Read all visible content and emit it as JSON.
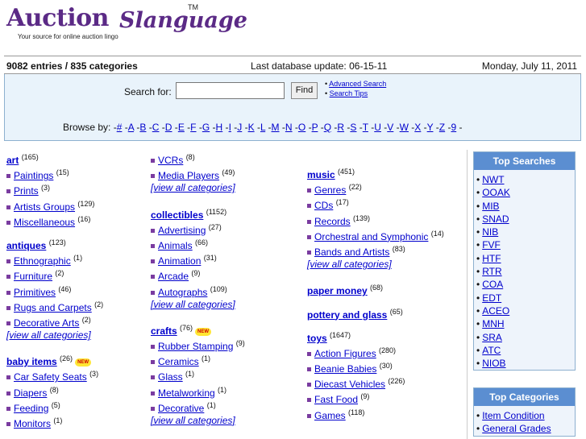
{
  "logo": {
    "main": "Auction",
    "script": "Slanguage",
    "tm": "TM",
    "tagline": "Your source for online auction lingo"
  },
  "info": {
    "entries": "9082 entries / 835 categories",
    "updated": "Last database update: 06-15-11",
    "date": "Monday, July 11, 2011"
  },
  "search": {
    "label": "Search for:",
    "input_value": "",
    "button": "Find",
    "advanced": "Advanced Search",
    "tips": "Search Tips",
    "browse_label": "Browse by:",
    "letters": [
      "#",
      "A",
      "B",
      "C",
      "D",
      "E",
      "F",
      "G",
      "H",
      "I",
      "J",
      "K",
      "L",
      "M",
      "N",
      "O",
      "P",
      "Q",
      "R",
      "S",
      "T",
      "U",
      "V",
      "W",
      "X",
      "Y",
      "Z",
      "9"
    ]
  },
  "columns": {
    "col1": [
      {
        "name": "art",
        "count": "165",
        "subs": [
          {
            "name": "Paintings",
            "count": "15"
          },
          {
            "name": "Prints",
            "count": "3"
          },
          {
            "name": "Artists Groups",
            "count": "129"
          },
          {
            "name": "Miscellaneous",
            "count": "16"
          }
        ],
        "viewall": ""
      },
      {
        "name": "antiques",
        "count": "123",
        "subs": [
          {
            "name": "Ethnographic",
            "count": "1"
          },
          {
            "name": "Furniture",
            "count": "2"
          },
          {
            "name": "Primitives",
            "count": "46"
          },
          {
            "name": "Rugs and Carpets",
            "count": "2"
          },
          {
            "name": "Decorative Arts",
            "count": "2"
          }
        ],
        "viewall": "[view all categories]"
      },
      {
        "name": "baby items",
        "count": "26",
        "new": "NEW",
        "subs": [
          {
            "name": "Car Safety Seats",
            "count": "3"
          },
          {
            "name": "Diapers",
            "count": "8"
          },
          {
            "name": "Feeding",
            "count": "5"
          },
          {
            "name": "Monitors",
            "count": "1"
          }
        ],
        "viewall": ""
      }
    ],
    "col2": [
      {
        "name": "",
        "count": "",
        "subs": [
          {
            "name": "VCRs",
            "count": "8"
          },
          {
            "name": "Media Players",
            "count": "49"
          }
        ],
        "viewall": "[view all categories]"
      },
      {
        "name": "collectibles",
        "count": "1152",
        "subs": [
          {
            "name": "Advertising",
            "count": "27"
          },
          {
            "name": "Animals",
            "count": "66"
          },
          {
            "name": "Animation",
            "count": "31"
          },
          {
            "name": "Arcade",
            "count": "9"
          },
          {
            "name": "Autographs",
            "count": "109"
          }
        ],
        "viewall": "[view all categories]"
      },
      {
        "name": "crafts",
        "count": "76",
        "new": "NEW",
        "subs": [
          {
            "name": "Rubber Stamping",
            "count": "9"
          },
          {
            "name": "Ceramics",
            "count": "1"
          },
          {
            "name": "Glass",
            "count": "1"
          },
          {
            "name": "Metalworking",
            "count": "1"
          },
          {
            "name": "Decorative",
            "count": "1"
          }
        ],
        "viewall": "[view all categories]"
      }
    ],
    "col3": [
      {
        "name": "music",
        "count": "451",
        "subs": [
          {
            "name": "Genres",
            "count": "22"
          },
          {
            "name": "CDs",
            "count": "17"
          },
          {
            "name": "Records",
            "count": "139"
          },
          {
            "name": "Orchestral and Symphonic",
            "count": "14"
          },
          {
            "name": "Bands and Artists",
            "count": "83"
          }
        ],
        "viewall": "[view all categories]"
      },
      {
        "name": "paper money",
        "count": "68",
        "subs": [],
        "viewall": ""
      },
      {
        "name": "pottery and glass",
        "count": "65",
        "subs": [],
        "viewall": ""
      },
      {
        "name": "toys",
        "count": "1647",
        "subs": [
          {
            "name": "Action Figures",
            "count": "280"
          },
          {
            "name": "Beanie Babies",
            "count": "30"
          },
          {
            "name": "Diecast Vehicles",
            "count": "226"
          },
          {
            "name": "Fast Food",
            "count": "9"
          },
          {
            "name": "Games",
            "count": "118"
          }
        ],
        "viewall": ""
      }
    ]
  },
  "sidebar": {
    "top_searches_title": "Top Searches",
    "top_searches": [
      "NWT",
      "OOAK",
      "MIB",
      "SNAD",
      "NIB",
      "FVF",
      "HTF",
      "RTR",
      "COA",
      "EDT",
      "ACEO",
      "MNH",
      "SRA",
      "ATC",
      "NIOB"
    ],
    "top_categories_title": "Top Categories",
    "top_categories": [
      "Item Condition",
      "General Grades"
    ]
  },
  "colors": {
    "brand": "#5b2a86",
    "link": "#0000cc",
    "bullet": "#7a3ca0",
    "box_bg": "#e9f3fb",
    "box_title": "#5b8ed1"
  }
}
